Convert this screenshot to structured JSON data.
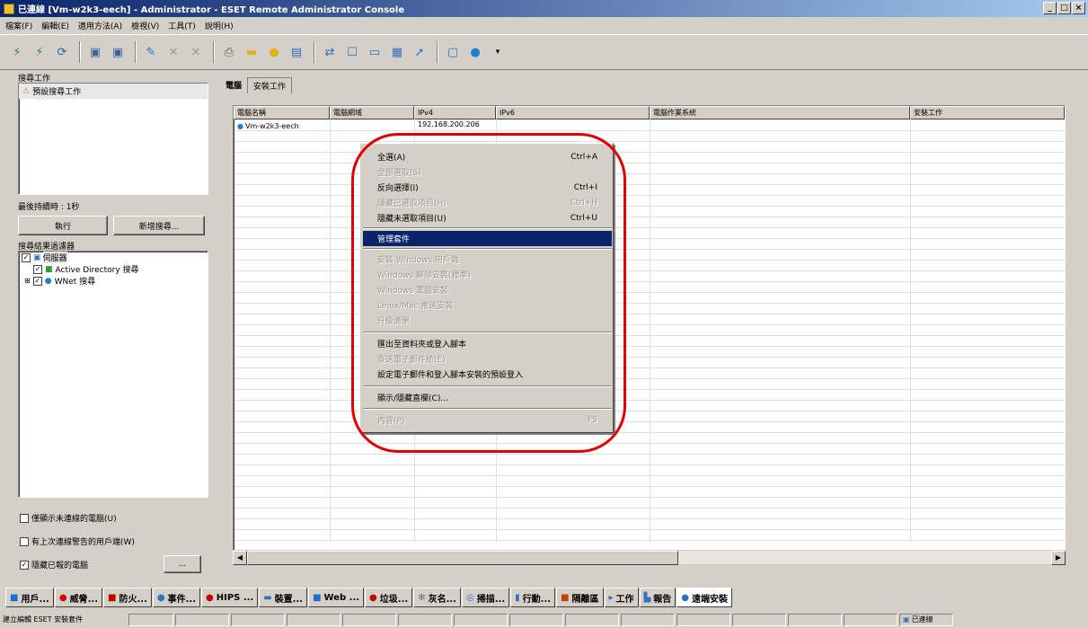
{
  "window": {
    "title": "已連線 [Vm-w2k3-eech] - Administrator - ESET Remote Administrator Console",
    "controls": [
      "_",
      "□",
      "×"
    ]
  },
  "menu": [
    "檔案(F)",
    "編輯(E)",
    "適用方法(A)",
    "檢視(V)",
    "工具(T)",
    "說明(H)"
  ],
  "toolbar": {
    "icons": [
      "connect-icon",
      "disconnect-icon",
      "refresh-icon",
      "client-icon",
      "client-delete-icon",
      "new-task-icon",
      "delete-icon",
      "delete-all-icon",
      "print-icon",
      "folder-icon",
      "policy-icon",
      "report-icon",
      "sync-icon",
      "view-list-icon",
      "view-detail-icon",
      "view-grid-icon",
      "arrow-icon",
      "console-icon",
      "help-icon"
    ]
  },
  "left_pane": {
    "tasks_label": "搜尋工作",
    "task_item": "預設搜尋工作",
    "last_run": "最後持續時 : 1秒",
    "run_button": "執行",
    "new_search_button": "新增搜尋...",
    "filter_label": "搜尋結果過濾器",
    "tree": [
      {
        "label": "伺服器",
        "level": 0
      },
      {
        "label": "Active Directory 搜尋",
        "level": 1
      },
      {
        "label": "WNet 搜尋",
        "level": 1
      }
    ],
    "check_show_unconnected": "僅顯示未連線的電腦(U)",
    "check_last_warning": "有上次連線警告的用戶端(W)",
    "check_hide_dup": "隱藏已報的電腦",
    "small_button": "..."
  },
  "tabs": [
    "電腦",
    "安裝工作"
  ],
  "list": {
    "columns": [
      "電腦名稱",
      "電腦網域",
      "IPv4",
      "IPv6",
      "電腦作業系統",
      "安裝工作"
    ],
    "rows": [
      {
        "name": "Vm-w2k3-eech",
        "domain": "",
        "ipv4": "192.168.200.206",
        "ipv6": "",
        "os": "",
        "task": ""
      }
    ]
  },
  "context_menu": {
    "items": [
      {
        "label": "全選(A)",
        "shortcut": "Ctrl+A",
        "disabled": false
      },
      {
        "label": "全部選取(S)",
        "shortcut": "",
        "disabled": true
      },
      {
        "label": "反向選擇(I)",
        "shortcut": "Ctrl+I",
        "disabled": false
      },
      {
        "label": "隱藏已選取項目(H)",
        "shortcut": "Ctrl+H",
        "disabled": true
      },
      {
        "label": "隱藏未選取項目(U)",
        "shortcut": "Ctrl+U",
        "disabled": false
      },
      {
        "label": "管理套件",
        "shortcut": "",
        "disabled": false,
        "highlighted": true
      },
      {
        "label": "安裝 Windows 用戶端",
        "shortcut": "",
        "disabled": true
      },
      {
        "label": "Windows 解除安裝(標準)",
        "shortcut": "",
        "disabled": true
      },
      {
        "label": "Windows 電腦安裝",
        "shortcut": "",
        "disabled": true
      },
      {
        "label": "Linux/Mac 推送安裝",
        "shortcut": "",
        "disabled": true
      },
      {
        "label": "升級清單",
        "shortcut": "",
        "disabled": true
      },
      {
        "label": "匯出至資料夾或登入腳本",
        "shortcut": "",
        "disabled": false
      },
      {
        "label": "寄送電子郵件給(E)",
        "shortcut": "",
        "disabled": true
      },
      {
        "label": "設定電子郵件和登入腳本安裝的預設登入",
        "shortcut": "",
        "disabled": false
      },
      {
        "label": "顯示/隱藏直欄(C)...",
        "shortcut": "",
        "disabled": false
      },
      {
        "label": "內容(P)",
        "shortcut": "F5",
        "disabled": true
      }
    ]
  },
  "bottom_tabs": [
    {
      "label": "用戶...",
      "icon": "users-icon",
      "color": "#1a6fd0"
    },
    {
      "label": "威脅...",
      "icon": "threat-icon",
      "color": "#d00000"
    },
    {
      "label": "防火...",
      "icon": "firewall-icon",
      "color": "#c00000"
    },
    {
      "label": "事件...",
      "icon": "event-icon",
      "color": "#3070c0"
    },
    {
      "label": "HIPS ...",
      "icon": "hips-icon",
      "color": "#c00000"
    },
    {
      "label": "裝置...",
      "icon": "device-icon",
      "color": "#3070c0"
    },
    {
      "label": "Web ...",
      "icon": "web-icon",
      "color": "#1a6fd0"
    },
    {
      "label": "垃圾...",
      "icon": "spam-icon",
      "color": "#c00000"
    },
    {
      "label": "灰名...",
      "icon": "greylist-icon",
      "color": "#707070"
    },
    {
      "label": "掃描...",
      "icon": "scan-icon",
      "color": "#3070c0"
    },
    {
      "label": "行動...",
      "icon": "mobile-icon",
      "color": "#3070c0"
    },
    {
      "label": "隔離區",
      "icon": "quarantine-icon",
      "color": "#c04000"
    },
    {
      "label": "工作",
      "icon": "tasks-icon",
      "color": "#3070c0"
    },
    {
      "label": "報告",
      "icon": "report-icon",
      "color": "#3070c0"
    },
    {
      "label": "遠端安裝",
      "icon": "remote-install-icon",
      "color": "#3070c0",
      "active": true
    }
  ],
  "statusbar": {
    "left": "建立編輯 ESET 安裝套件",
    "right": "已連線"
  }
}
